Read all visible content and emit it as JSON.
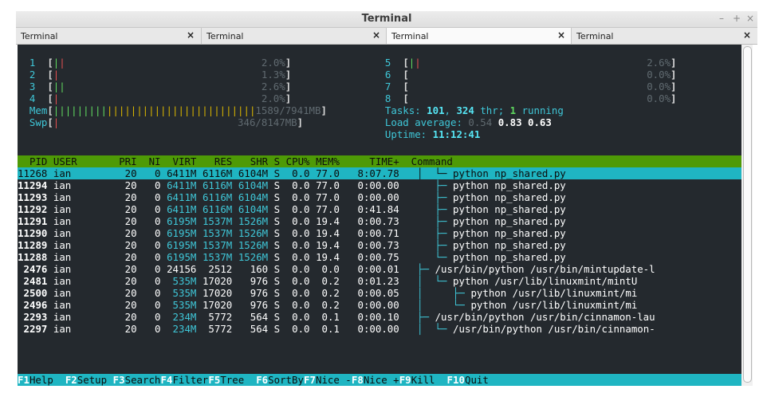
{
  "window": {
    "title": "Terminal",
    "controls": [
      "–",
      "+",
      "×"
    ]
  },
  "tabs": [
    {
      "label": "Terminal",
      "close": "×",
      "active": false
    },
    {
      "label": "Terminal",
      "close": "×",
      "active": false
    },
    {
      "label": "Terminal",
      "close": "×",
      "active": true
    },
    {
      "label": "Terminal",
      "close": "×",
      "active": false
    }
  ],
  "meters": {
    "cpus": [
      {
        "n": "1",
        "pct": "2.0%"
      },
      {
        "n": "2",
        "pct": "1.3%"
      },
      {
        "n": "3",
        "pct": "2.6%"
      },
      {
        "n": "4",
        "pct": "2.0%"
      },
      {
        "n": "5",
        "pct": "2.6%"
      },
      {
        "n": "6",
        "pct": "0.0%"
      },
      {
        "n": "7",
        "pct": "0.0%"
      },
      {
        "n": "8",
        "pct": "0.0%"
      }
    ],
    "mem_label": "Mem",
    "mem_value": "1589/7941MB",
    "swp_label": "Swp",
    "swp_value": "346/8147MB",
    "tasks_label": "Tasks:",
    "tasks": "101",
    "thr": "324",
    "thr_label": "thr;",
    "running": "1",
    "running_label": "running",
    "load_label": "Load average:",
    "load1": "0.54",
    "load5": "0.83",
    "load15": "0.63",
    "uptime_label": "Uptime:",
    "uptime": "11:12:41"
  },
  "columns": [
    "PID",
    "USER",
    "PRI",
    "NI",
    "VIRT",
    "RES",
    "SHR",
    "S",
    "CPU%",
    "MEM%",
    "TIME+",
    "Command"
  ],
  "rows": [
    {
      "pid": "11268",
      "user": "ian",
      "pri": "20",
      "ni": "0",
      "virt": "6411M",
      "res": "6116M",
      "shr": "6104M",
      "s": "S",
      "cpu": "0.0",
      "mem": "77.0",
      "time": "8:07.78",
      "tree": "│  └─",
      "cmd": "python np_shared.py",
      "selected": true
    },
    {
      "pid": "11294",
      "user": "ian",
      "pri": "20",
      "ni": "0",
      "virt": "6411M",
      "res": "6116M",
      "shr": "6104M",
      "s": "S",
      "cpu": "0.0",
      "mem": "77.0",
      "time": "0:00.00",
      "tree": "   ├─",
      "cmd": "python np_shared.py"
    },
    {
      "pid": "11293",
      "user": "ian",
      "pri": "20",
      "ni": "0",
      "virt": "6411M",
      "res": "6116M",
      "shr": "6104M",
      "s": "S",
      "cpu": "0.0",
      "mem": "77.0",
      "time": "0:00.00",
      "tree": "   ├─",
      "cmd": "python np_shared.py"
    },
    {
      "pid": "11292",
      "user": "ian",
      "pri": "20",
      "ni": "0",
      "virt": "6411M",
      "res": "6116M",
      "shr": "6104M",
      "s": "S",
      "cpu": "0.0",
      "mem": "77.0",
      "time": "0:41.84",
      "tree": "   ├─",
      "cmd": "python np_shared.py"
    },
    {
      "pid": "11291",
      "user": "ian",
      "pri": "20",
      "ni": "0",
      "virt": "6195M",
      "res": "1537M",
      "shr": "1526M",
      "s": "S",
      "cpu": "0.0",
      "mem": "19.4",
      "time": "0:00.73",
      "tree": "   ├─",
      "cmd": "python np_shared.py"
    },
    {
      "pid": "11290",
      "user": "ian",
      "pri": "20",
      "ni": "0",
      "virt": "6195M",
      "res": "1537M",
      "shr": "1526M",
      "s": "S",
      "cpu": "0.0",
      "mem": "19.4",
      "time": "0:00.71",
      "tree": "   ├─",
      "cmd": "python np_shared.py"
    },
    {
      "pid": "11289",
      "user": "ian",
      "pri": "20",
      "ni": "0",
      "virt": "6195M",
      "res": "1537M",
      "shr": "1526M",
      "s": "S",
      "cpu": "0.0",
      "mem": "19.4",
      "time": "0:00.73",
      "tree": "   ├─",
      "cmd": "python np_shared.py"
    },
    {
      "pid": "11288",
      "user": "ian",
      "pri": "20",
      "ni": "0",
      "virt": "6195M",
      "res": "1537M",
      "shr": "1526M",
      "s": "S",
      "cpu": "0.0",
      "mem": "19.4",
      "time": "0:00.75",
      "tree": "   └─",
      "cmd": "python np_shared.py"
    },
    {
      "pid": "2476",
      "user": "ian",
      "pri": "20",
      "ni": "0",
      "virt": "24156",
      "res": "2512",
      "shr": "160",
      "s": "S",
      "cpu": "0.0",
      "mem": "0.0",
      "time": "0:00.01",
      "tree": "├─",
      "cmd": "/usr/bin/python /usr/bin/mintupdate-l"
    },
    {
      "pid": "2481",
      "user": "ian",
      "pri": "20",
      "ni": "0",
      "virt": "535M",
      "res": "17020",
      "shr": "976",
      "s": "S",
      "cpu": "0.0",
      "mem": "0.2",
      "time": "0:01.23",
      "tree": "│  └─",
      "cmd": "python /usr/lib/linuxmint/mintU"
    },
    {
      "pid": "2500",
      "user": "ian",
      "pri": "20",
      "ni": "0",
      "virt": "535M",
      "res": "17020",
      "shr": "976",
      "s": "S",
      "cpu": "0.0",
      "mem": "0.2",
      "time": "0:00.05",
      "tree": "│     ├─",
      "cmd": "python /usr/lib/linuxmint/mi"
    },
    {
      "pid": "2496",
      "user": "ian",
      "pri": "20",
      "ni": "0",
      "virt": "535M",
      "res": "17020",
      "shr": "976",
      "s": "S",
      "cpu": "0.0",
      "mem": "0.2",
      "time": "0:00.00",
      "tree": "│     └─",
      "cmd": "python /usr/lib/linuxmint/mi"
    },
    {
      "pid": "2293",
      "user": "ian",
      "pri": "20",
      "ni": "0",
      "virt": "234M",
      "res": "5772",
      "shr": "564",
      "s": "S",
      "cpu": "0.0",
      "mem": "0.1",
      "time": "0:00.10",
      "tree": "├─",
      "cmd": "/usr/bin/python /usr/bin/cinnamon-lau"
    },
    {
      "pid": "2297",
      "user": "ian",
      "pri": "20",
      "ni": "0",
      "virt": "234M",
      "res": "5772",
      "shr": "564",
      "s": "S",
      "cpu": "0.0",
      "mem": "0.1",
      "time": "0:00.00",
      "tree": "│  └─",
      "cmd": "/usr/bin/python /usr/bin/cinnamon-"
    }
  ],
  "footer": [
    {
      "key": "F1",
      "label": "Help"
    },
    {
      "key": "F2",
      "label": "Setup"
    },
    {
      "key": "F3",
      "label": "Search"
    },
    {
      "key": "F4",
      "label": "Filter"
    },
    {
      "key": "F5",
      "label": "Tree"
    },
    {
      "key": "F6",
      "label": "SortBy"
    },
    {
      "key": "F7",
      "label": "Nice -"
    },
    {
      "key": "F8",
      "label": "Nice +"
    },
    {
      "key": "F9",
      "label": "Kill"
    },
    {
      "key": "F10",
      "label": "Quit"
    }
  ]
}
